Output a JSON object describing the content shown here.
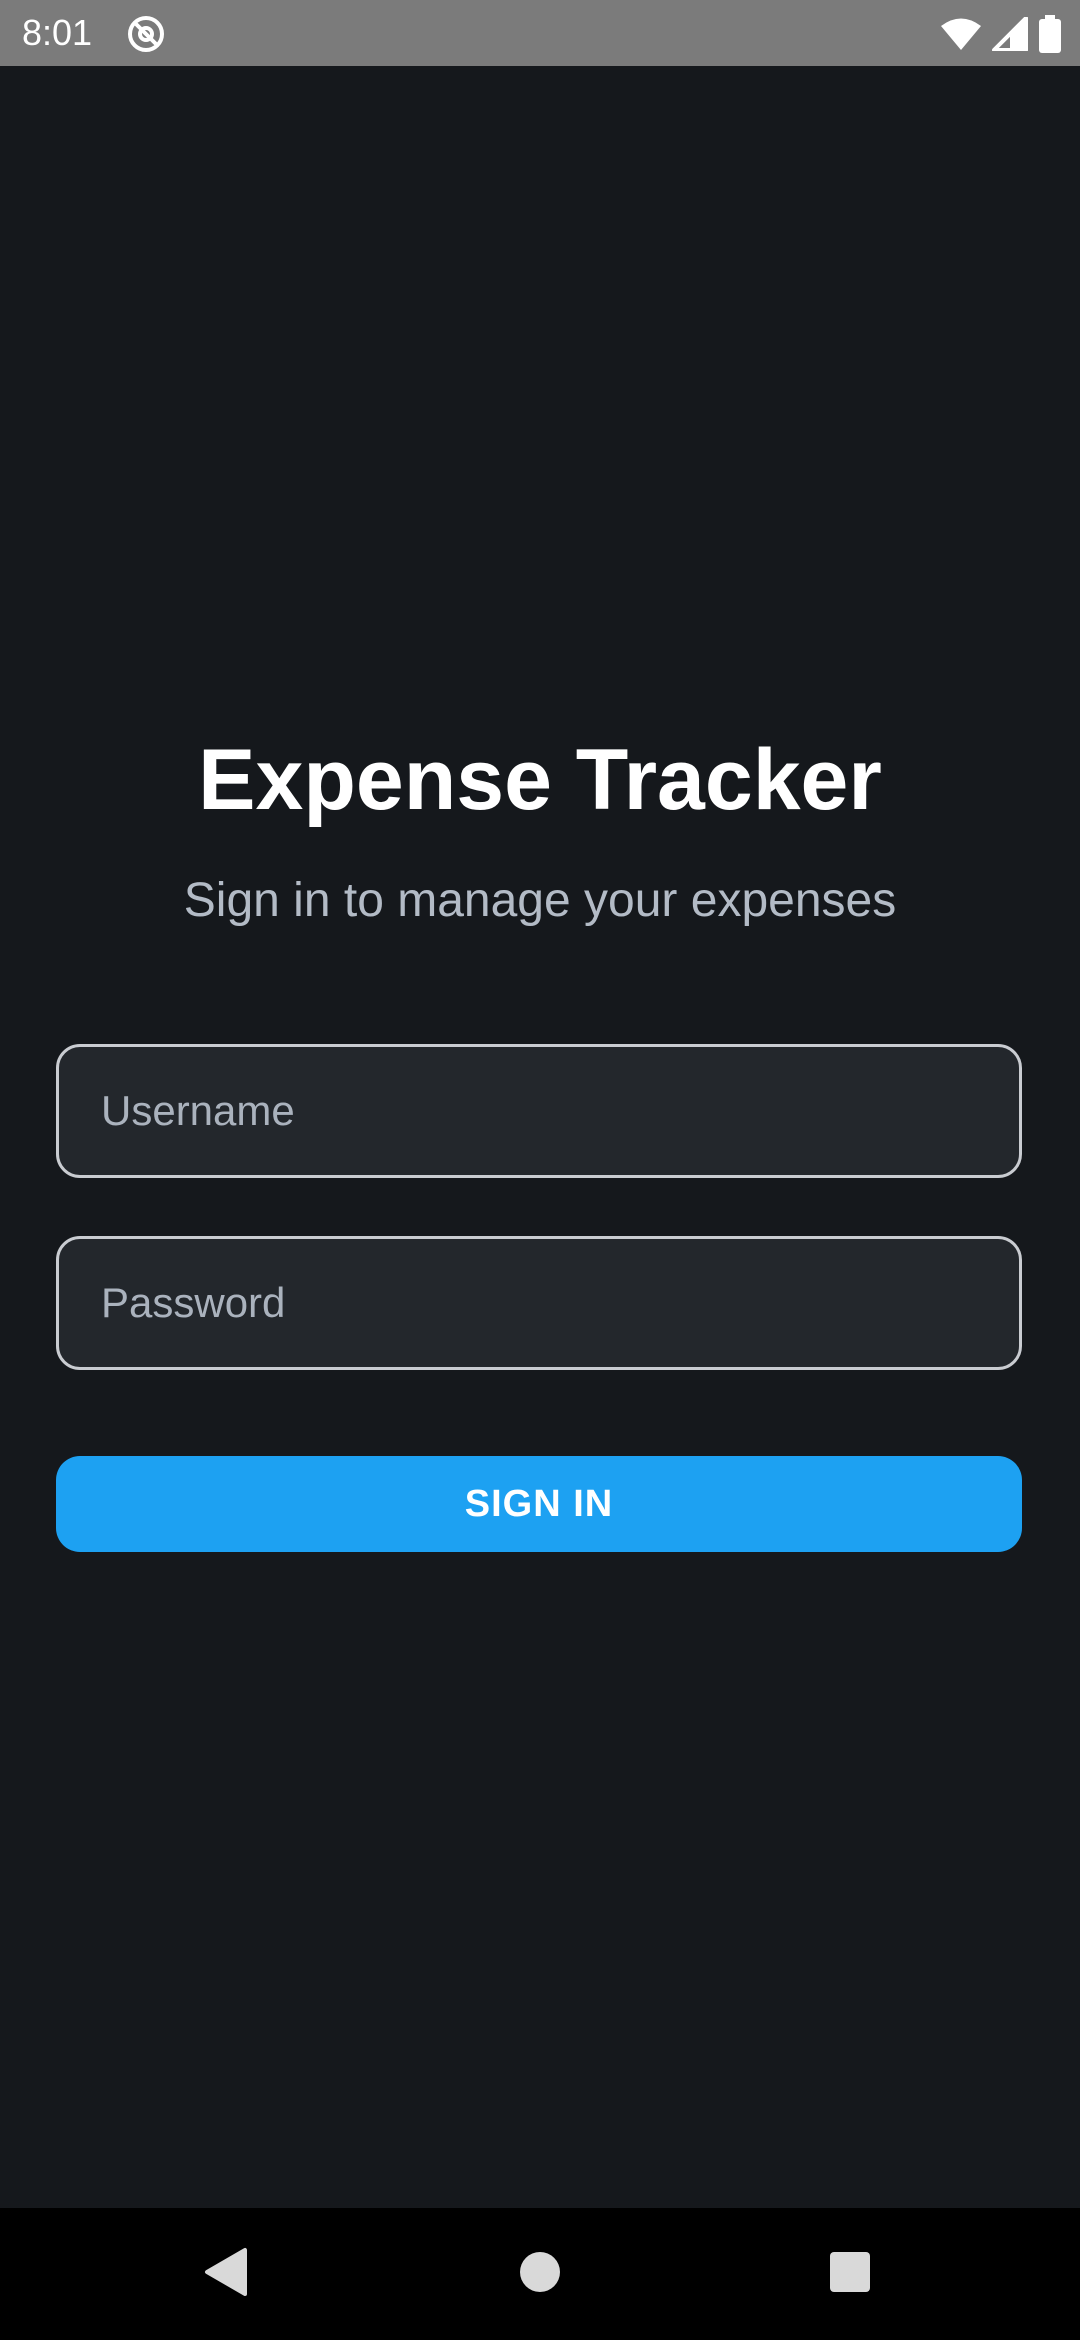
{
  "status_bar": {
    "time": "8:01",
    "app_icon": "at-sign-icon",
    "icons": [
      "wifi-icon",
      "cellular-signal-icon",
      "battery-icon"
    ]
  },
  "login": {
    "title": "Expense Tracker",
    "subtitle": "Sign in to manage your expenses",
    "username": {
      "placeholder": "Username",
      "value": ""
    },
    "password": {
      "placeholder": "Password",
      "value": ""
    },
    "sign_in_label": "SIGN IN"
  },
  "nav_bar": {
    "buttons": [
      "back-icon",
      "home-icon",
      "recents-icon"
    ]
  },
  "colors": {
    "background": "#15181c",
    "field_background": "#23272c",
    "accent": "#1da1f2",
    "status_bar": "#7b7b7b"
  }
}
